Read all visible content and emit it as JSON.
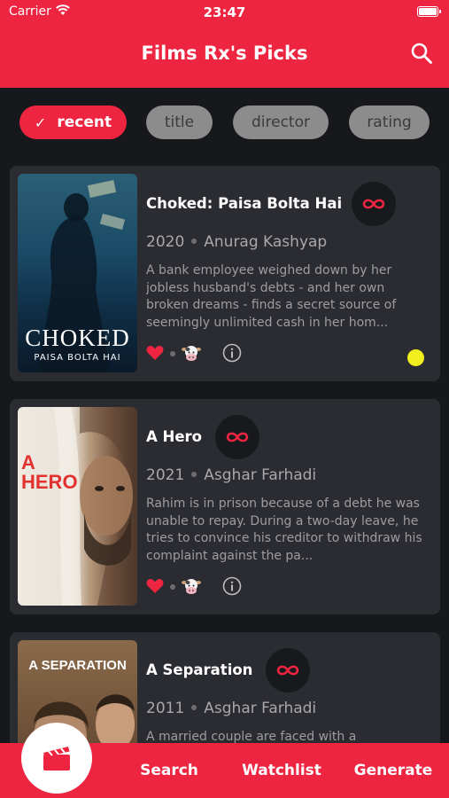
{
  "status": {
    "carrier": "Carrier",
    "time": "23:47"
  },
  "header": {
    "title": "Films Rx's Picks",
    "search_icon": "search-icon"
  },
  "chips": [
    {
      "label": "recent",
      "active": true
    },
    {
      "label": "title",
      "active": false
    },
    {
      "label": "director",
      "active": false
    },
    {
      "label": "rating",
      "active": false
    }
  ],
  "films": [
    {
      "title": "Choked: Paisa Bolta Hai",
      "year": "2020",
      "director": "Anurag Kashyap",
      "description": "A bank employee weighed down by her jobless husband's debts - and her own broken dreams - finds a secret source of seemingly unlimited cash in her hom...",
      "poster_title": "CHOKED",
      "poster_subtitle": "PAISA BOLTA HAI",
      "liked": true,
      "seen": true
    },
    {
      "title": "A Hero",
      "year": "2021",
      "director": "Asghar Farhadi",
      "description": "Rahim is in prison because of a debt he was unable to repay. During a two-day leave, he tries to convince his creditor to withdraw his complaint against the pa...",
      "poster_title": "A HERO",
      "liked": true,
      "seen": false
    },
    {
      "title": "A Separation",
      "year": "2011",
      "director": "Asghar Farhadi",
      "description": "A married couple are faced with a",
      "poster_title": "A SEPARATION",
      "liked": false,
      "seen": false
    }
  ],
  "tabbar": {
    "search": "Search",
    "watchlist": "Watchlist",
    "generate": "Generate",
    "home_icon": "clapperboard-icon"
  },
  "colors": {
    "accent": "#ed2540",
    "background": "#17181c",
    "card": "#2b2c31",
    "seen": "#f2ef1e"
  }
}
